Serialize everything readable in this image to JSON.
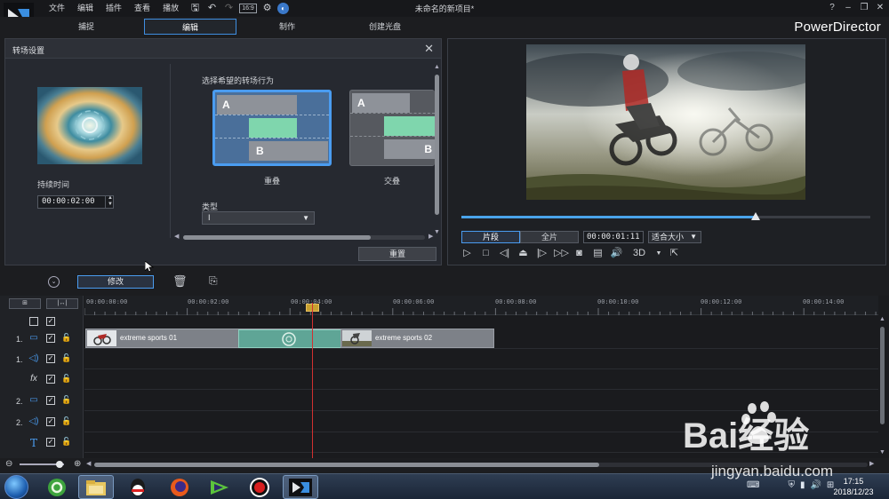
{
  "app": {
    "window_title": "未命名的新项目*",
    "brand": "PowerDirector",
    "menu": [
      "文件",
      "编辑",
      "插件",
      "查看",
      "播放"
    ],
    "modes": [
      "捕捉",
      "编辑",
      "制作",
      "创建光盘"
    ],
    "active_mode": "编辑"
  },
  "transition_panel": {
    "title": "转场设置",
    "duration_label": "持续时间",
    "duration": "00:00:02:00",
    "choose_label": "选择希望的转场行为",
    "options": [
      {
        "name": "重叠",
        "selected": true
      },
      {
        "name": "交叠",
        "selected": false
      }
    ],
    "track_a": "A",
    "track_b": "B",
    "type_label": "类型",
    "type_value": "I",
    "reset_label": "重置"
  },
  "preview": {
    "mode_clip": "片段",
    "mode_full": "全片",
    "timecode": "00:00:01:11",
    "fit_label": "适合大小",
    "label_3d": "3D",
    "progress": 0.72
  },
  "toolbar": {
    "modify_label": "修改"
  },
  "timeline": {
    "ruler_labels": [
      "00:00:00:00",
      "00:00:02:00",
      "00:00:04:00",
      "00:00:06:00",
      "00:00:08:00",
      "00:00:10:00",
      "00:00:12:00",
      "00:00:14:00"
    ],
    "tracks": [
      {
        "num": "1.",
        "kind": "video"
      },
      {
        "num": "1.",
        "kind": "audio"
      },
      {
        "num": "",
        "kind": "fx",
        "label": "fx"
      },
      {
        "num": "2.",
        "kind": "video"
      },
      {
        "num": "2.",
        "kind": "audio"
      },
      {
        "num": "",
        "kind": "title",
        "label": "T"
      }
    ],
    "clips": [
      {
        "name": "extreme sports 01"
      },
      {
        "name": "extreme sports 02"
      }
    ]
  },
  "taskbar": {
    "time": "17:15",
    "date": "2018/12/23"
  },
  "watermark": {
    "text": "Bai经验",
    "url": "jingyan.baidu.com"
  },
  "colors": {
    "accent": "#4a9cf0",
    "transition": "#7fd6ad",
    "playhead": "#d23030"
  }
}
